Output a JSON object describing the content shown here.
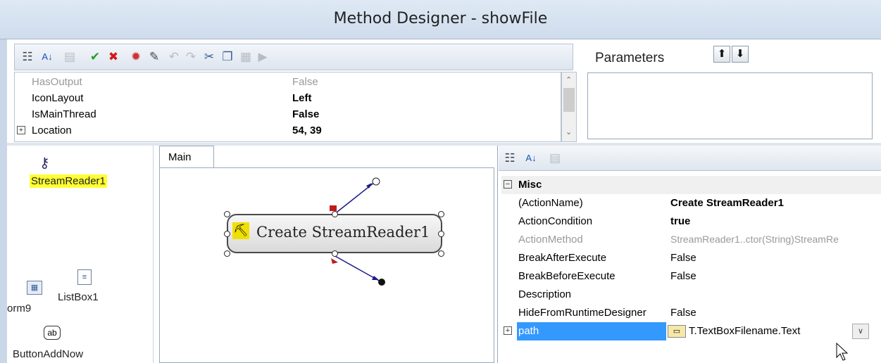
{
  "window": {
    "title": "Method Designer - showFile"
  },
  "toolbar": {
    "icons": [
      "categorized-icon",
      "alphabetical-icon",
      "property-pages-icon",
      "ok-check-icon",
      "cancel-x-icon",
      "debug-icon",
      "wand-icon",
      "undo-icon",
      "redo-icon",
      "cut-icon",
      "copy-icon",
      "paste-icon",
      "run-icon"
    ]
  },
  "properties": {
    "rows": [
      {
        "name": "HasOutput",
        "value": "False",
        "bold": false,
        "dim": true
      },
      {
        "name": "IconLayout",
        "value": "Left",
        "bold": true,
        "dim": false
      },
      {
        "name": "IsMainThread",
        "value": "False",
        "bold": true,
        "dim": false
      },
      {
        "name": "Location",
        "value": "54, 39",
        "bold": true,
        "dim": false,
        "expandable": true
      }
    ]
  },
  "parameters": {
    "label": "Parameters",
    "up": "up-arrow-icon",
    "down": "down-arrow-icon"
  },
  "components": [
    {
      "label": "StreamReader1",
      "icon": "key-icon",
      "highlighted": true
    },
    {
      "label": "ListBox1",
      "icon": "listbox-icon"
    },
    {
      "label": "orm9",
      "icon": "form-icon"
    },
    {
      "label": "ButtonAddNow",
      "icon": "button-ab-icon",
      "icon_text": "ab"
    }
  ],
  "designer": {
    "tab": "Main",
    "action": {
      "label": "Create StreamReader1",
      "icon": "action-runner-icon"
    }
  },
  "action_props": {
    "group": "Misc",
    "rows": [
      {
        "name": "(ActionName)",
        "value": "Create StreamReader1",
        "bold": true
      },
      {
        "name": "ActionCondition",
        "value": "true",
        "bold": true
      },
      {
        "name": "ActionMethod",
        "value": "StreamReader1..ctor(String)StreamRe",
        "dim": true
      },
      {
        "name": "BreakAfterExecute",
        "value": "False"
      },
      {
        "name": "BreakBeforeExecute",
        "value": "False"
      },
      {
        "name": "Description",
        "value": ""
      },
      {
        "name": "HideFromRuntimeDesigner",
        "value": "False"
      },
      {
        "name": "path",
        "value": "T.TextBoxFilename.Text",
        "selected": true,
        "expandable": true
      }
    ]
  }
}
